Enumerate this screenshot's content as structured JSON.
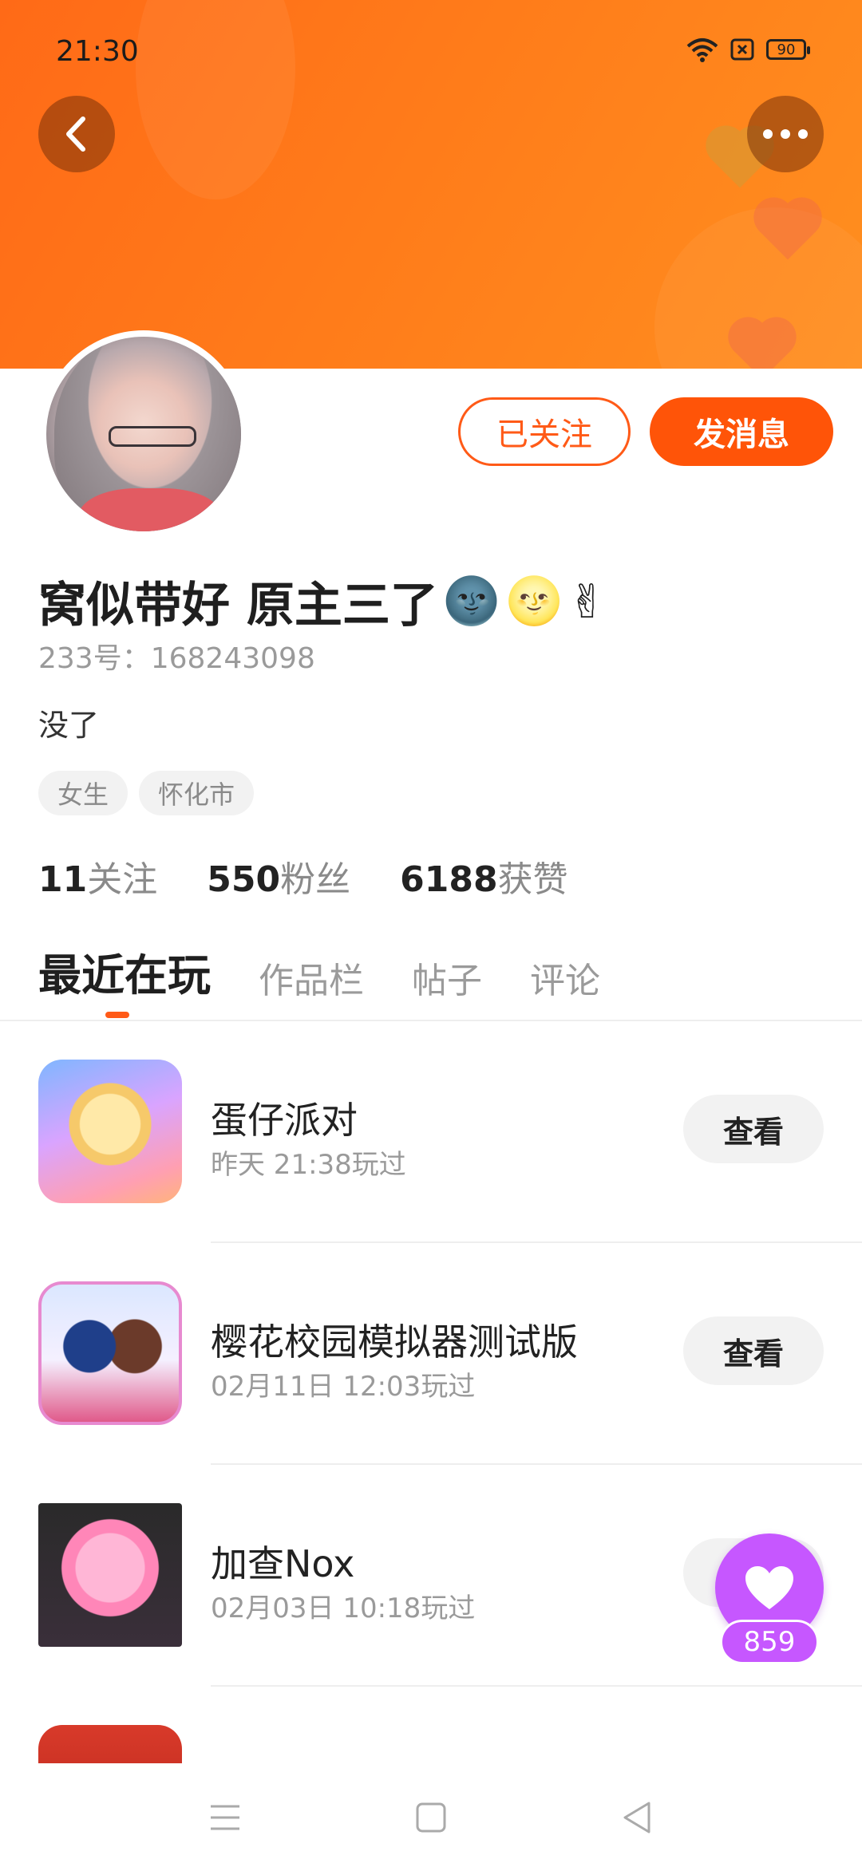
{
  "status_bar": {
    "time": "21:30",
    "battery": "90"
  },
  "profile": {
    "nickname": "窝似带好 原主三了",
    "nickname_emojis": [
      "🌚",
      "🌝",
      "✌"
    ],
    "id_text": "233号：168243098",
    "bio": "没了",
    "tags": [
      "女生",
      "怀化市"
    ],
    "followed_label": "已关注",
    "message_label": "发消息"
  },
  "stats": [
    {
      "num": "11",
      "label": "关注"
    },
    {
      "num": "550",
      "label": "粉丝"
    },
    {
      "num": "6188",
      "label": "获赞"
    }
  ],
  "tabs": [
    "最近在玩",
    "作品栏",
    "帖子",
    "评论"
  ],
  "games": [
    {
      "title": "蛋仔派对",
      "time": "昨天 21:38玩过",
      "action": "查看"
    },
    {
      "title": "樱花校园模拟器测试版",
      "time": "02月11日 12:03玩过",
      "action": "查看"
    },
    {
      "title": "加查Nox",
      "time": "02月03日 10:18玩过",
      "action": ""
    }
  ],
  "float_like": {
    "count": "859"
  },
  "colors": {
    "accent": "#ff5a17",
    "banner": "#ff7b1a",
    "like": "#c657ff"
  },
  "icons": [
    "back-arrow-icon",
    "more-dots-icon",
    "wifi-icon",
    "sim-icon",
    "battery-icon",
    "heart-icon",
    "menu-icon",
    "home-square-icon",
    "back-triangle-icon"
  ]
}
